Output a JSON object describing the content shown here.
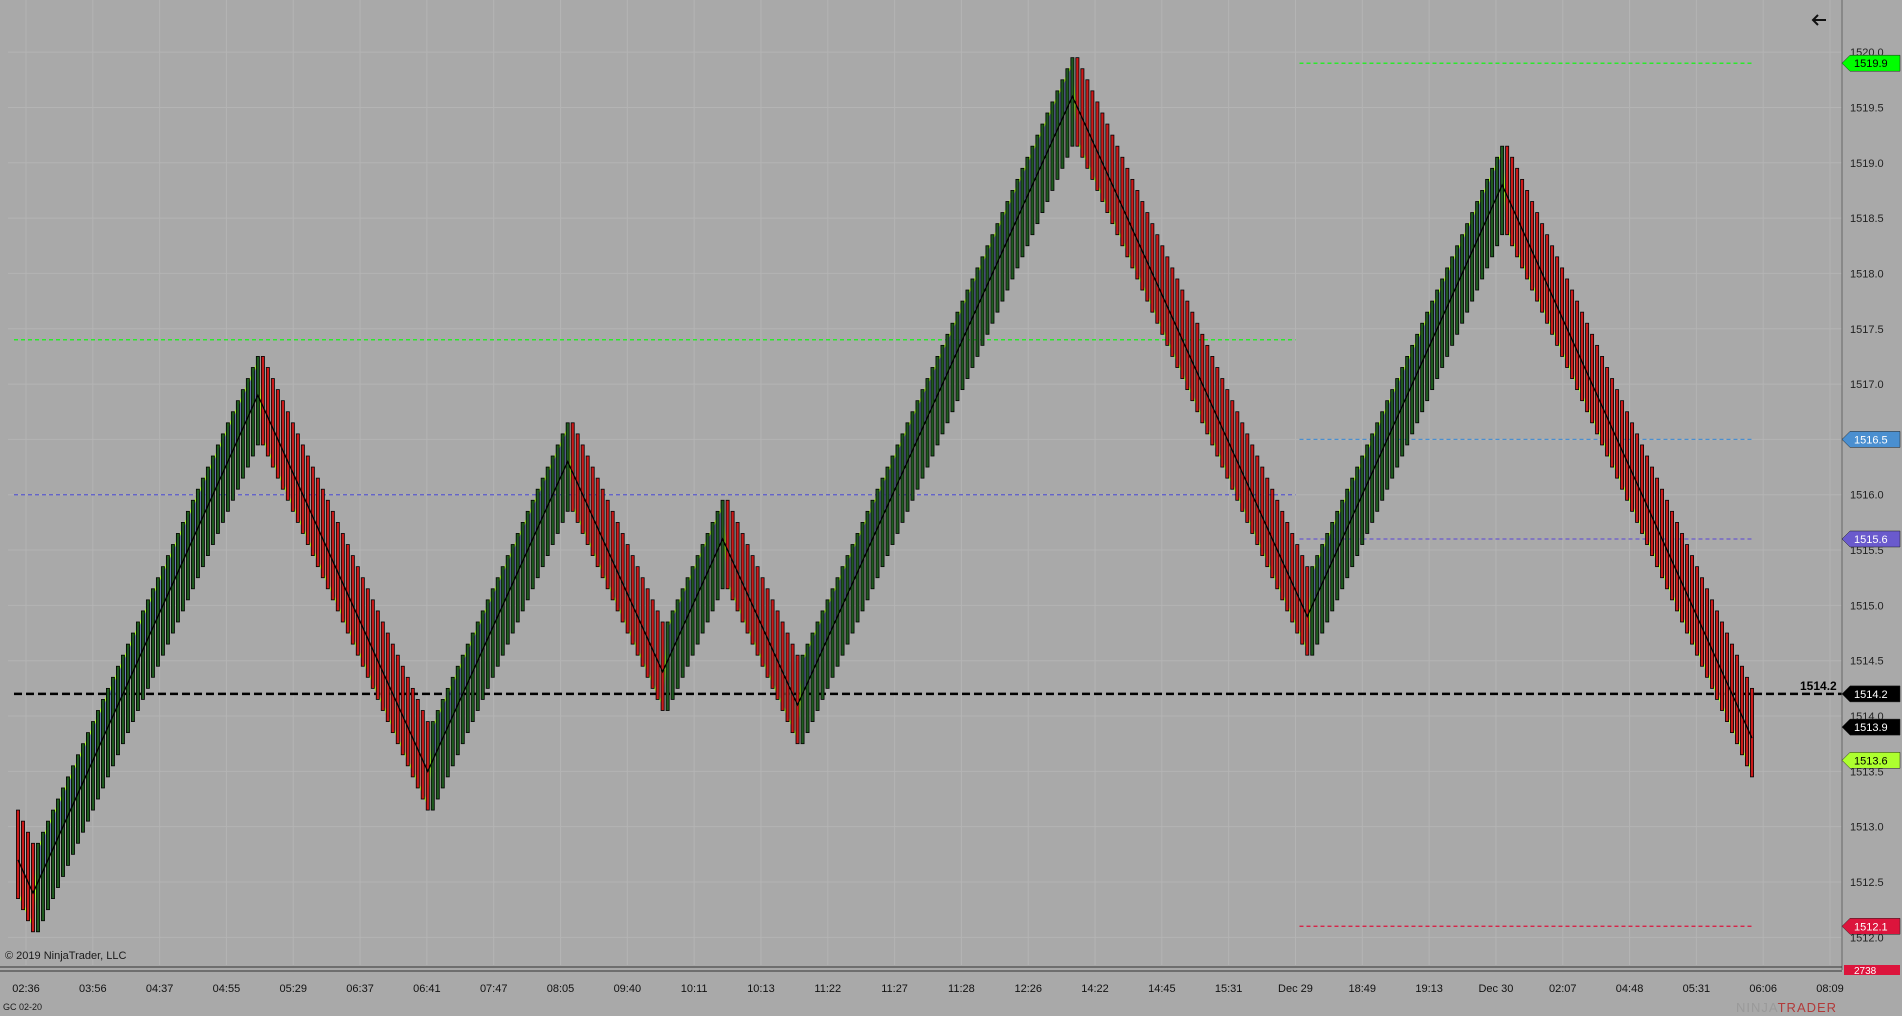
{
  "window": {
    "instrument": "GC 02-20",
    "copyright": "© 2019 NinjaTrader, LLC",
    "logo_left": "NINJA",
    "logo_right": "TRADER"
  },
  "colors": {
    "background": "#a9a9a9",
    "up_bar": "#1f5c1f",
    "down_bar": "#cc1a1a",
    "band_up": "#5b6fb5",
    "band_down": "#d58a7a",
    "band_edge": "#adff2f",
    "close_line": "#000000"
  },
  "icons": {
    "back": "arrow-left-icon"
  },
  "chart_data": {
    "type": "candlestick-renko",
    "y_axis": {
      "min": 1512.0,
      "max": 1520.0,
      "ticks": [
        1512.0,
        1512.5,
        1513.0,
        1513.5,
        1514.0,
        1514.5,
        1515.0,
        1515.5,
        1516.0,
        1516.5,
        1517.0,
        1517.5,
        1518.0,
        1518.5,
        1519.0,
        1519.5,
        1520.0
      ]
    },
    "x_ticks": [
      "02:36",
      "03:56",
      "04:37",
      "04:55",
      "05:29",
      "06:37",
      "06:41",
      "07:47",
      "08:05",
      "09:40",
      "10:11",
      "10:13",
      "11:22",
      "11:27",
      "11:28",
      "12:26",
      "14:22",
      "14:45",
      "15:31",
      "Dec 29",
      "18:49",
      "19:13",
      "Dec 30",
      "02:07",
      "04:48",
      "05:31",
      "06:06",
      "08:09"
    ],
    "last_price": 1514.2,
    "price_labels": [
      {
        "value": 1519.9,
        "label": "1519.9",
        "color": "#00ff00",
        "text_color": "#000000"
      },
      {
        "value": 1516.5,
        "label": "1516.5",
        "color": "#4a8fd0",
        "text_color": "#ffffff"
      },
      {
        "value": 1515.6,
        "label": "1515.6",
        "color": "#6a5acd",
        "text_color": "#ffffff"
      },
      {
        "value": 1514.2,
        "label": "1514.2",
        "color": "#000000",
        "text_color": "#ffffff"
      },
      {
        "value": 1513.9,
        "label": "1513.9",
        "color": "#000000",
        "text_color": "#ffffff"
      },
      {
        "value": 1513.6,
        "label": "1513.6",
        "color": "#adff2f",
        "text_color": "#000000"
      },
      {
        "value": 1512.1,
        "label": "1512.1",
        "color": "#dc143c",
        "text_color": "#ffffff"
      }
    ],
    "volume_label": "2738",
    "horizontal_lines": [
      {
        "value": 1519.9,
        "color": "#00ff00",
        "style": "dashed",
        "from": "Dec 29",
        "to": "end"
      },
      {
        "value": 1517.4,
        "color": "#00ff00",
        "style": "dashed",
        "from": "start",
        "to": "Dec 29"
      },
      {
        "value": 1516.0,
        "color": "#5a5acd",
        "style": "dashed",
        "from": "start",
        "to": "Dec 29"
      },
      {
        "value": 1516.5,
        "color": "#4a8fd0",
        "style": "dashed",
        "from": "Dec 29",
        "to": "end"
      },
      {
        "value": 1515.6,
        "color": "#6a5acd",
        "style": "dashed",
        "from": "Dec 29",
        "to": "end"
      },
      {
        "value": 1512.1,
        "color": "#dc143c",
        "style": "dashed",
        "from": "Dec 29",
        "to": "end"
      },
      {
        "value": 1514.2,
        "color": "#000000",
        "style": "dashed-bold",
        "from": "start",
        "to": "end"
      }
    ],
    "box_size": 0.1,
    "swings": [
      {
        "from": 1512.8,
        "to": 1512.4,
        "dir": "down"
      },
      {
        "from": 1512.4,
        "to": 1516.9,
        "dir": "up"
      },
      {
        "from": 1516.9,
        "to": 1513.5,
        "dir": "down"
      },
      {
        "from": 1513.5,
        "to": 1516.3,
        "dir": "up"
      },
      {
        "from": 1516.3,
        "to": 1514.4,
        "dir": "down"
      },
      {
        "from": 1514.4,
        "to": 1515.6,
        "dir": "up"
      },
      {
        "from": 1515.6,
        "to": 1514.1,
        "dir": "down"
      },
      {
        "from": 1514.1,
        "to": 1519.6,
        "dir": "up"
      },
      {
        "from": 1519.6,
        "to": 1514.9,
        "dir": "down"
      },
      {
        "from": 1514.9,
        "to": 1518.8,
        "dir": "up"
      },
      {
        "from": 1518.8,
        "to": 1513.8,
        "dir": "down"
      }
    ]
  }
}
